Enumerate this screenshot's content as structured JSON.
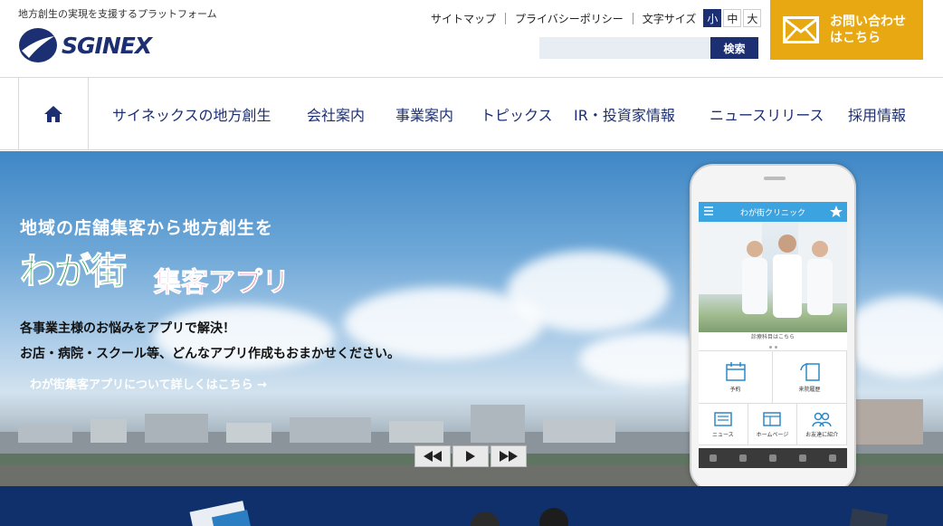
{
  "header": {
    "tagline": "地方創生の実現を支援するプラットフォーム",
    "logo_text": "SGINEX",
    "utility": {
      "sitemap": "サイトマップ",
      "privacy": "プライバシーポリシー",
      "font_size_label": "文字サイズ",
      "font_small": "小",
      "font_medium": "中",
      "font_large": "大"
    },
    "search": {
      "button": "検索",
      "placeholder": ""
    },
    "contact": {
      "line1": "お問い合わせ",
      "line2": "はこちら"
    }
  },
  "nav": {
    "items": [
      "サイネックスの地方創生",
      "会社案内",
      "事業案内",
      "トピックス",
      "IR・投資家情報",
      "ニュースリリース",
      "採用情報"
    ]
  },
  "hero": {
    "lead": "地域の店舗集客から地方創生を",
    "app_title_main": "わが街",
    "app_title_sub": "集客アプリ",
    "desc_line1": "各事業主様のお悩みをアプリで解決！",
    "desc_line2": "お店・病院・スクール等、どんなアプリ作成もおまかせください。",
    "link": "わが街集客アプリについて詳しくはこちら →"
  },
  "phone": {
    "app_name": "わが街クリニック",
    "menu_label": "MENU",
    "member_label": "MEMBER",
    "photo_caption": "診療科目はこちら",
    "tiles": [
      "予約",
      "来院履歴"
    ],
    "tiles3": [
      "ニュース",
      "ホームページ",
      "お友達に紹介"
    ]
  },
  "colors": {
    "brand_navy": "#1b2f72",
    "contact_gold": "#e8a811",
    "band_navy": "#10306c"
  }
}
